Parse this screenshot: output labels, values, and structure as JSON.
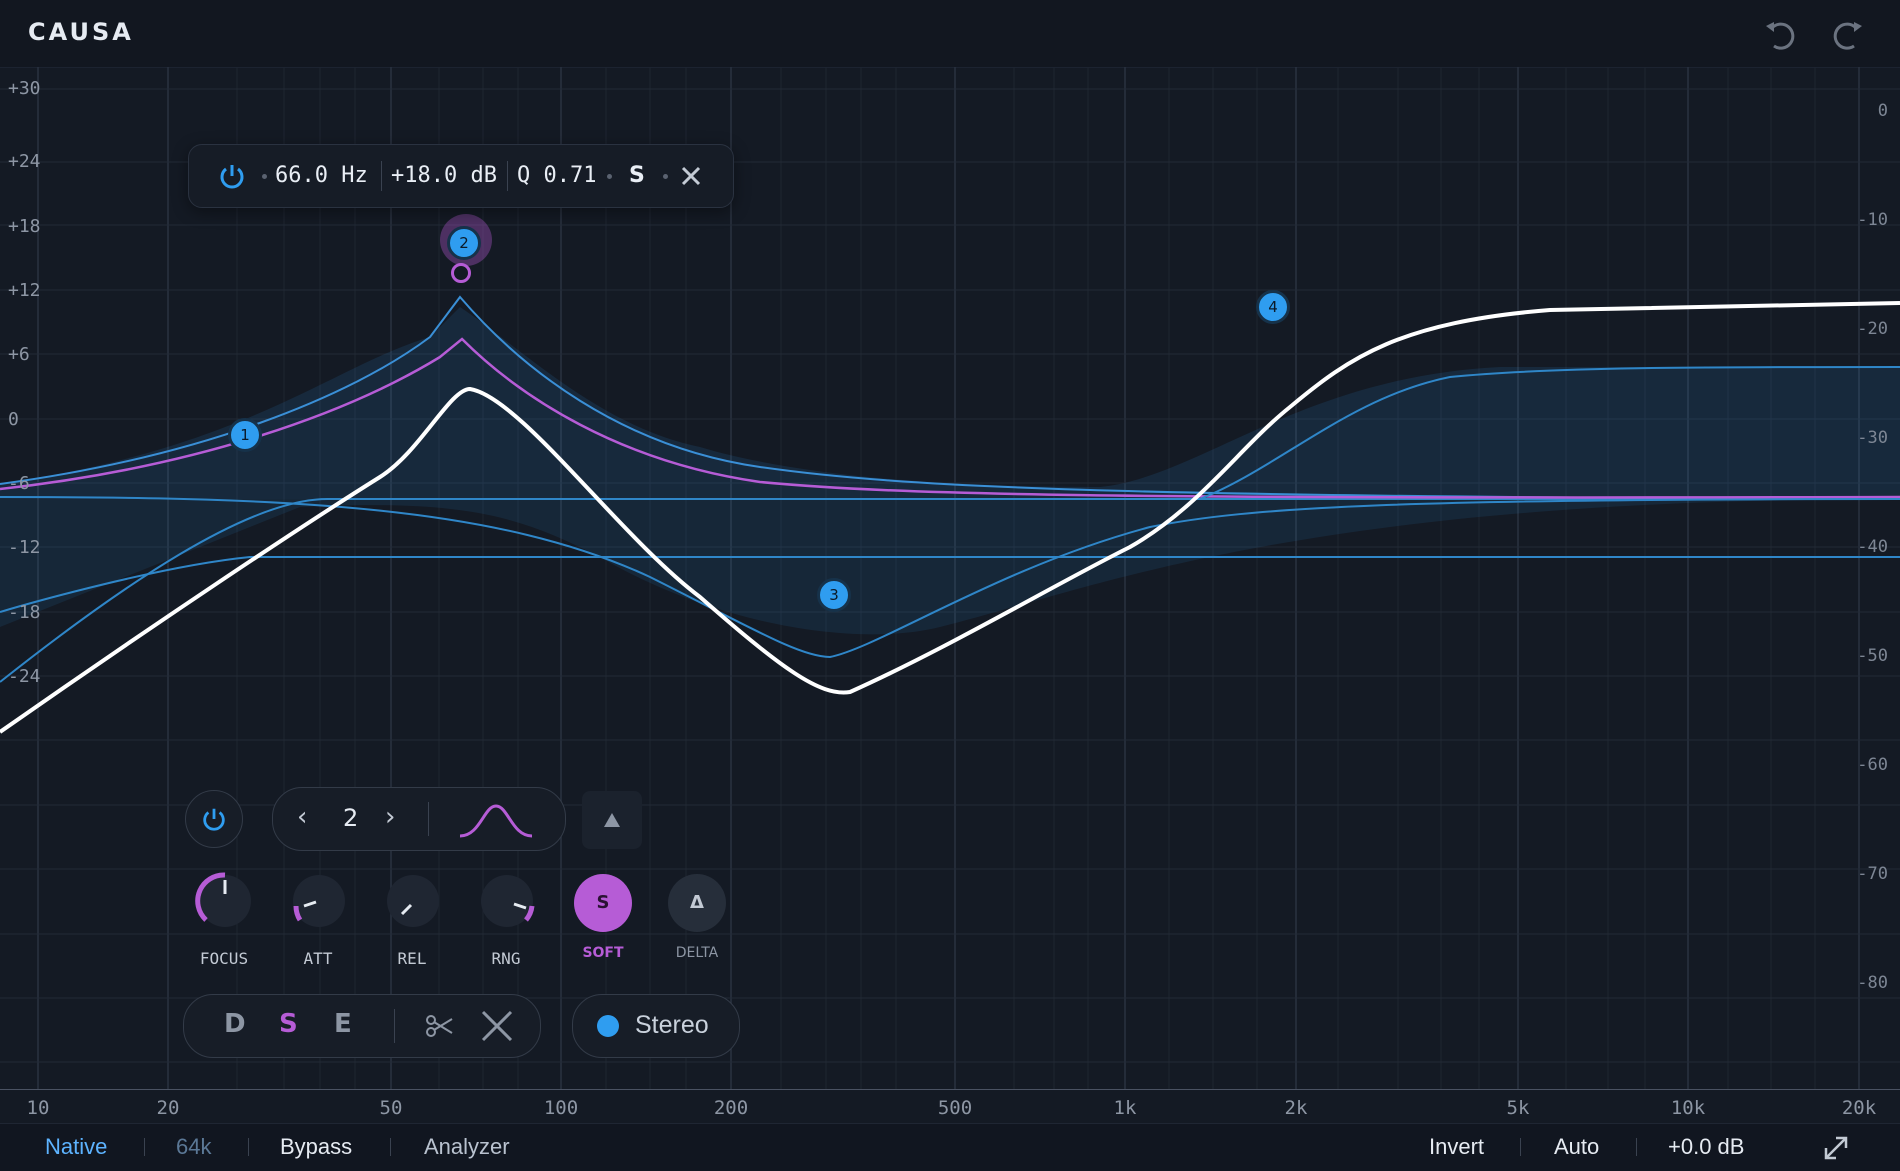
{
  "app": {
    "title": "CAUSA"
  },
  "toolbar": {
    "undo_icon": "undo-icon",
    "redo_icon": "redo-icon"
  },
  "graph": {
    "y_left_labels": [
      "+30",
      "+24",
      "+18",
      "+12",
      "+6",
      "0",
      "-6",
      "-12",
      "-18",
      "-24"
    ],
    "y_right_labels": [
      "0",
      "-10",
      "-20",
      "-30",
      "-40",
      "-50",
      "-60",
      "-70",
      "-80"
    ],
    "x_labels": [
      "10",
      "20",
      "50",
      "100",
      "200",
      "500",
      "1k",
      "2k",
      "5k",
      "10k",
      "20k"
    ],
    "bands": [
      {
        "id": "1",
        "freq_hz": 25,
        "gain_db": 0
      },
      {
        "id": "2",
        "freq_hz": 66,
        "gain_db": 17
      },
      {
        "id": "3",
        "freq_hz": 310,
        "gain_db": -15
      },
      {
        "id": "4",
        "freq_hz": 1800,
        "gain_db": 12
      }
    ]
  },
  "band_popup": {
    "power_icon": "power-icon",
    "freq": "66.0 Hz",
    "gain": "+18.0 dB",
    "q": "Q 0.71",
    "mode": "S",
    "close_icon": "close-icon"
  },
  "band_panel": {
    "band_number": "2",
    "shape_icon": "bell-shape-icon",
    "knobs": [
      {
        "label": "FOCUS",
        "level": 0.5
      },
      {
        "label": "ATT",
        "level": 0.12
      },
      {
        "label": "REL",
        "level": 0.1
      },
      {
        "label": "RNG",
        "level": 0.85
      }
    ],
    "soft": {
      "glyph": "S",
      "label": "SOFT"
    },
    "delta": {
      "glyph": "Δ",
      "label": "DELTA"
    },
    "dse": [
      "D",
      "S",
      "E"
    ],
    "channel": "Stereo"
  },
  "bottom": {
    "native": "Native",
    "rate": "64k",
    "bypass": "Bypass",
    "analyzer": "Analyzer",
    "invert": "Invert",
    "auto": "Auto",
    "gain": "+0.0 dB"
  },
  "colors": {
    "accent": "#2f9df0",
    "purple": "#b65cd6",
    "bg": "#141a24"
  }
}
